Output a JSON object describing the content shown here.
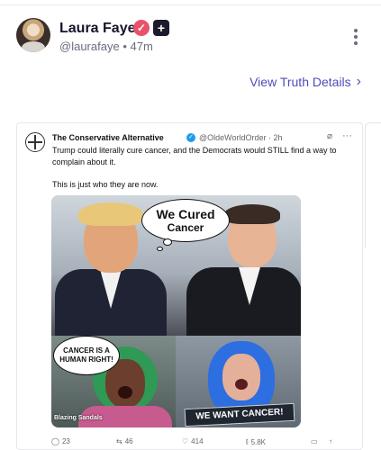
{
  "post": {
    "author_name": "Laura Faye",
    "handle": "@laurafaye",
    "separator": "•",
    "time": "47m",
    "view_details": "View Truth Details",
    "chevron": "›"
  },
  "embed": {
    "author_name": "The Conservative Alternative",
    "handle_time": "@OldeWorldOrder · 2h",
    "text_1": "Trump could literally cure cancer, and the Democrats would STILL find a way to complain about it.",
    "text_2": "This is just who they are now.",
    "meme": {
      "bubble_top_line1": "We Cured",
      "bubble_top_line2": "Cancer",
      "bubble_left_line1": "CANCER IS A",
      "bubble_left_line2": "HUMAN RIGHT!",
      "watermark": "Blazing Sandals",
      "sign_text": "WE WANT CANCER!"
    },
    "actions": {
      "replies": "23",
      "reposts": "46",
      "likes": "414",
      "views": "5.8K"
    }
  },
  "icons": {
    "verified": "verified-badge-icon",
    "plus": "plus-badge-icon",
    "more": "more-vertical-icon",
    "chevron": "chevron-right-icon"
  },
  "colors": {
    "accent": "#4f4cb8",
    "verified": "#e8536b",
    "embed_verified": "#1d9bf0"
  }
}
